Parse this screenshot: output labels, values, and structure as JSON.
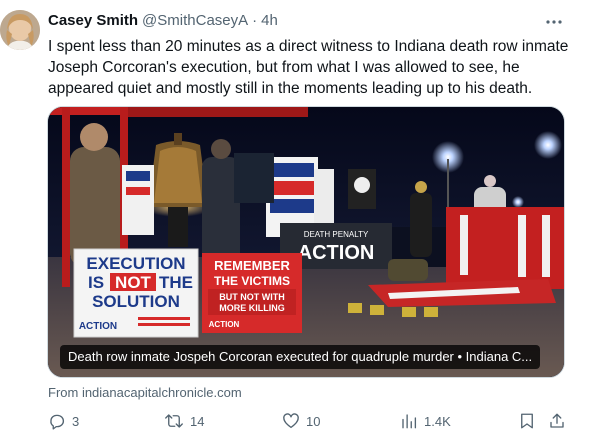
{
  "author": {
    "name": "Casey Smith",
    "handle": "@SmithCaseyA",
    "separator": "·",
    "time": "4h"
  },
  "tweet": {
    "text": "I spent less than 20 minutes as a direct witness to Indiana death row inmate Joseph Corcoran's execution, but from what I was allowed to see, he appeared quiet and mostly still in the moments leading up to his death."
  },
  "media": {
    "caption": "Death row inmate Jospeh Corcoran executed for quadruple murder • Indiana C...",
    "signs": {
      "exec_line1": "EXECUTION",
      "exec_line2_a": "IS",
      "exec_line2_b": "NOT",
      "exec_line2_c": "THE",
      "exec_line3": "SOLUTION",
      "exec_brand": "ACTION",
      "remember_line1": "REMEMBER",
      "remember_line2": "THE VICTIMS",
      "remember_line3": "BUT NOT WITH",
      "remember_line4": "MORE KILLING",
      "remember_brand": "ACTION",
      "banner_line1": "DEATH PENALTY",
      "banner_line2": "ACTION"
    }
  },
  "source": {
    "text": "From indianacapitalchronicle.com"
  },
  "actions": {
    "replies": "3",
    "retweets": "14",
    "likes": "10",
    "views": "1.4K"
  },
  "colors": {
    "muted": "#536471",
    "text": "#0f1419",
    "sign_red": "#d62a2a",
    "sign_navy": "#1d3a8a"
  }
}
